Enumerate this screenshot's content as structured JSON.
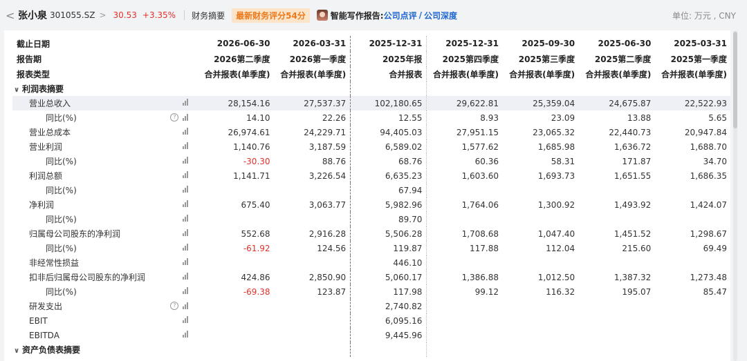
{
  "header": {
    "back_glyph": "<",
    "stock_name": "张小泉",
    "stock_code": "301055.SZ",
    "arrow": ">",
    "price": "30.53",
    "change_pct": "+3.35%",
    "fin_summary_label": "财务摘要",
    "score_badge": "最新财务评分54分",
    "ai_report_label": "智能写作报告:",
    "link_review": "公司点评",
    "link_sep": "/",
    "link_depth": "公司深度",
    "unit": "单位: 万元 , CNY",
    "accent_red": "#e0312b",
    "badge_color": "#ea7a1c",
    "link_color": "#1e66d0"
  },
  "table": {
    "header_rows": [
      {
        "label": "截止日期",
        "cols": [
          "2026-06-30",
          "2026-03-31",
          "2025-12-31",
          "2025-12-31",
          "2025-09-30",
          "2025-06-30",
          "2025-03-31"
        ]
      },
      {
        "label": "报告期",
        "cols": [
          "2026第二季度",
          "2026第一季度",
          "2025年报",
          "2025第四季度",
          "2025第三季度",
          "2025第二季度",
          "2025第一季度"
        ]
      },
      {
        "label": "报表类型",
        "cols": [
          "合并报表(单季度)",
          "合并报表(单季度)",
          "合并报表",
          "合并报表(单季度)",
          "合并报表(单季度)",
          "合并报表(单季度)",
          "合并报表(单季度)"
        ]
      }
    ],
    "section_income": "利润表摘要",
    "section_balance": "资产负债表摘要",
    "rows": [
      {
        "label": "营业总收入",
        "level": 1,
        "q": false,
        "vals": [
          "28,154.16",
          "27,537.37",
          "102,180.65",
          "29,622.81",
          "25,359.04",
          "24,675.87",
          "22,522.93"
        ]
      },
      {
        "label": "同比(%)",
        "level": 2,
        "q": true,
        "vals": [
          "14.10",
          "22.26",
          "12.55",
          "8.93",
          "23.09",
          "13.88",
          "5.65"
        ]
      },
      {
        "label": "营业总成本",
        "level": 1,
        "q": false,
        "vals": [
          "26,974.61",
          "24,229.71",
          "94,405.03",
          "27,951.15",
          "23,065.32",
          "22,440.73",
          "20,947.84"
        ]
      },
      {
        "label": "营业利润",
        "level": 1,
        "q": false,
        "vals": [
          "1,140.76",
          "3,187.59",
          "6,589.02",
          "1,577.62",
          "1,685.98",
          "1,636.72",
          "1,688.70"
        ]
      },
      {
        "label": "同比(%)",
        "level": 2,
        "q": false,
        "vals": [
          "-30.30",
          "88.76",
          "68.76",
          "60.36",
          "58.31",
          "171.87",
          "34.70"
        ]
      },
      {
        "label": "利润总额",
        "level": 1,
        "q": false,
        "vals": [
          "1,141.71",
          "3,226.54",
          "6,635.23",
          "1,603.60",
          "1,693.73",
          "1,651.55",
          "1,686.35"
        ]
      },
      {
        "label": "同比(%)",
        "level": 2,
        "q": false,
        "vals": [
          "",
          "",
          "67.94",
          "",
          "",
          "",
          ""
        ]
      },
      {
        "label": "净利润",
        "level": 1,
        "q": false,
        "vals": [
          "675.40",
          "3,063.77",
          "5,982.96",
          "1,764.06",
          "1,300.92",
          "1,493.92",
          "1,424.07"
        ]
      },
      {
        "label": "同比(%)",
        "level": 2,
        "q": false,
        "vals": [
          "",
          "",
          "89.70",
          "",
          "",
          "",
          ""
        ]
      },
      {
        "label": "归属母公司股东的净利润",
        "level": 1,
        "q": false,
        "vals": [
          "552.68",
          "2,916.28",
          "5,506.28",
          "1,708.68",
          "1,047.40",
          "1,451.52",
          "1,298.67"
        ]
      },
      {
        "label": "同比(%)",
        "level": 2,
        "q": false,
        "vals": [
          "-61.92",
          "124.56",
          "119.87",
          "117.88",
          "112.04",
          "215.60",
          "69.49"
        ]
      },
      {
        "label": "非经常性损益",
        "level": 1,
        "q": false,
        "vals": [
          "",
          "",
          "446.10",
          "",
          "",
          "",
          ""
        ]
      },
      {
        "label": "扣非后归属母公司股东的净利润",
        "level": 1,
        "q": false,
        "vals": [
          "424.86",
          "2,850.90",
          "5,060.17",
          "1,386.88",
          "1,012.50",
          "1,387.32",
          "1,273.48"
        ]
      },
      {
        "label": "同比(%)",
        "level": 2,
        "q": false,
        "vals": [
          "-69.38",
          "123.87",
          "117.98",
          "99.12",
          "116.32",
          "195.07",
          "85.47"
        ]
      },
      {
        "label": "研发支出",
        "level": 1,
        "q": true,
        "vals": [
          "",
          "",
          "2,740.82",
          "",
          "",
          "",
          ""
        ]
      },
      {
        "label": "EBIT",
        "level": 1,
        "q": false,
        "vals": [
          "",
          "",
          "6,095.16",
          "",
          "",
          "",
          ""
        ]
      },
      {
        "label": "EBITDA",
        "level": 1,
        "q": false,
        "vals": [
          "",
          "",
          "9,445.96",
          "",
          "",
          "",
          ""
        ]
      }
    ]
  }
}
